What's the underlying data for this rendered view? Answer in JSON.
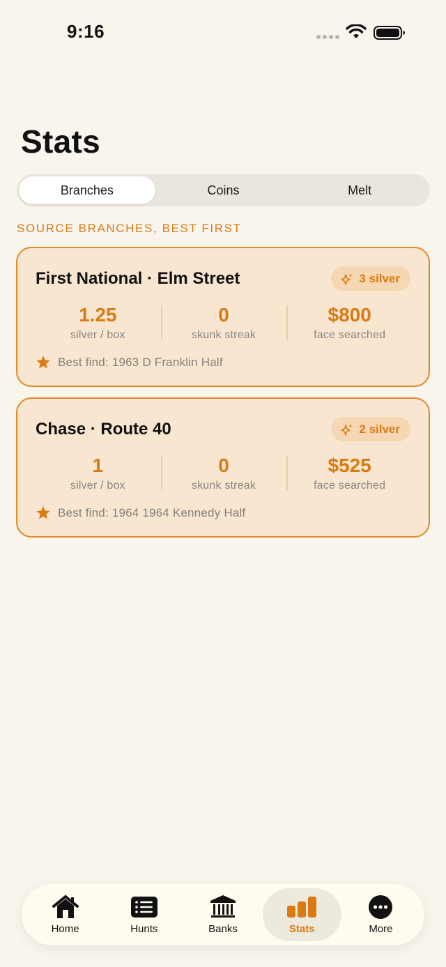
{
  "status_bar": {
    "time": "9:16"
  },
  "page": {
    "title": "Stats"
  },
  "segments": [
    {
      "label": "Branches",
      "active": true
    },
    {
      "label": "Coins",
      "active": false
    },
    {
      "label": "Melt",
      "active": false
    }
  ],
  "section_header": "SOURCE BRANCHES, BEST FIRST",
  "branches": [
    {
      "name": "First National · Elm Street",
      "badge": "3 silver",
      "stats": [
        {
          "value": "1.25",
          "label": "silver / box"
        },
        {
          "value": "0",
          "label": "skunk streak"
        },
        {
          "value": "$800",
          "label": "face searched"
        }
      ],
      "best_find": "Best find: 1963 D Franklin Half"
    },
    {
      "name": "Chase · Route 40",
      "badge": "2 silver",
      "stats": [
        {
          "value": "1",
          "label": "silver / box"
        },
        {
          "value": "0",
          "label": "skunk streak"
        },
        {
          "value": "$525",
          "label": "face searched"
        }
      ],
      "best_find": "Best find: 1964 1964 Kennedy Half"
    }
  ],
  "tabs": [
    {
      "label": "Home",
      "icon": "house-icon",
      "active": false
    },
    {
      "label": "Hunts",
      "icon": "list-icon",
      "active": false
    },
    {
      "label": "Banks",
      "icon": "bank-icon",
      "active": false
    },
    {
      "label": "Stats",
      "icon": "bar-chart-icon",
      "active": true
    },
    {
      "label": "More",
      "icon": "ellipsis-circle-icon",
      "active": false
    }
  ],
  "colors": {
    "accent": "#d97a12",
    "background": "#f9f4ec",
    "card": "#f8e6d1",
    "card_border": "#e0892a"
  }
}
